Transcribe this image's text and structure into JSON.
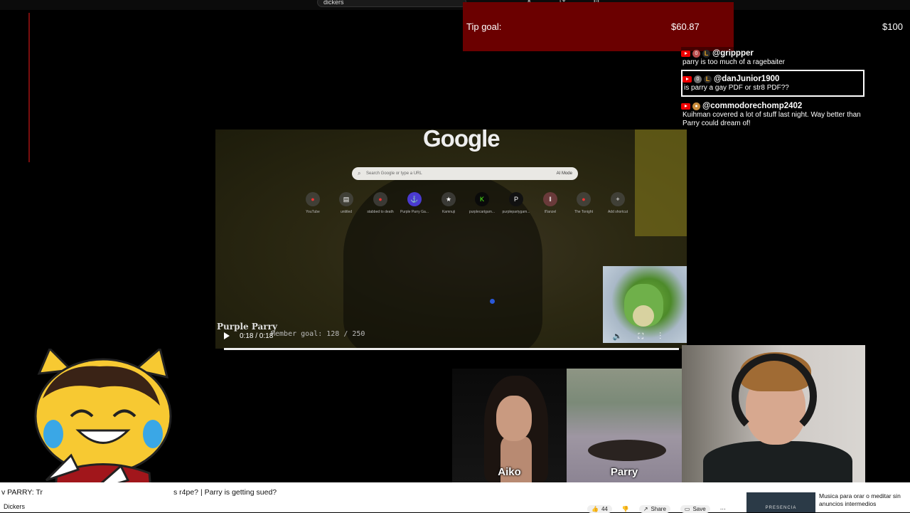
{
  "browser": {
    "search_value": "dickers"
  },
  "tip_goal": {
    "label": "Tip goal:",
    "current": "$60.87",
    "target": "$100",
    "progress_fraction": 0.61,
    "color": "#6b0000"
  },
  "chat": {
    "messages": [
      {
        "user": "@grippper",
        "text": "parry is too much of a ragebaiter",
        "highlighted": false
      },
      {
        "user": "@danJunior1900",
        "text": "is parry a gay PDF or str8 PDF??",
        "highlighted": true
      },
      {
        "user": "@commodorechomp2402",
        "text": "Kuihman covered a lot of stuff last night. Way better than Parry could dream of!",
        "highlighted": false
      }
    ]
  },
  "video": {
    "google_logo": "Google",
    "search_placeholder": "Search Google or type a URL",
    "ai_mode": "AI Mode",
    "shortcuts": [
      {
        "label": "YouTube",
        "icon": "youtube-icon"
      },
      {
        "label": "untitled",
        "icon": "page-icon"
      },
      {
        "label": "stabbed to death",
        "icon": "youtube-icon"
      },
      {
        "label": "Purple Parry Ga...",
        "icon": "anchor-icon"
      },
      {
        "label": "Kamnuji",
        "icon": "star-icon"
      },
      {
        "label": "purplecartgam...",
        "icon": "kick-icon"
      },
      {
        "label": "purplepartygam...",
        "icon": "patreon-icon"
      },
      {
        "label": "Il'lanzel",
        "icon": "pause-icon"
      },
      {
        "label": "The Tonight",
        "icon": "youtube-icon"
      },
      {
        "label": "Add shortcut",
        "icon": "plus-icon"
      }
    ],
    "member_goal": "Member goal: 128 / 250",
    "overlay_logo": "Purple Parry",
    "time": "0:18 / 0:18",
    "progress_fraction": 1.0
  },
  "webcams": {
    "left_label": "Aiko",
    "right_label": "Parry"
  },
  "youtube": {
    "title_left": "v PARRY: Tr",
    "title_right": "s r4pe? | Parry is getting sued?",
    "channel": "Dickers",
    "likes": "44",
    "share": "Share",
    "save": "Save",
    "recommended_title": "Musica para orar o meditar sin anuncios intermedios",
    "recommended_thumb": "PRESENCIA"
  }
}
